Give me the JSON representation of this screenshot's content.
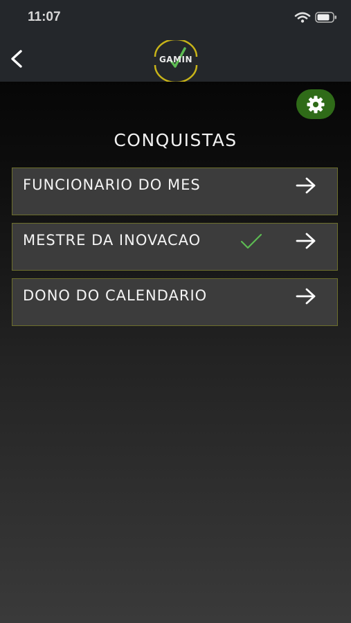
{
  "status_bar": {
    "time": "11:07"
  },
  "header": {
    "logo_text": "GAMIN"
  },
  "page": {
    "title": "CONQUISTAS"
  },
  "achievements": [
    {
      "label": "FUNCIONARIO DO MES",
      "completed": false
    },
    {
      "label": "MESTRE DA INOVACAO",
      "completed": true
    },
    {
      "label": "DONO DO CALENDARIO",
      "completed": false
    }
  ],
  "colors": {
    "accent_green": "#2f6b18",
    "check_green": "#5dbb52",
    "logo_ring": "#c8b419",
    "card_border": "#6d6f2c"
  },
  "icons": {
    "back": "chevron-left",
    "settings": "gear",
    "achievement_arrow": "arrow-right",
    "completed": "checkmark"
  }
}
